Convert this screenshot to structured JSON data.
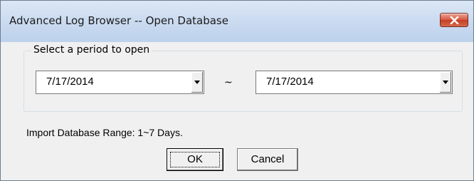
{
  "window": {
    "title": "Advanced Log Browser -- Open Database"
  },
  "titlebar_buttons": {
    "close_icon": "close-x-icon",
    "close_color": "#c9452f"
  },
  "period_group": {
    "legend": "Select a period to open",
    "start_date": "7/17/2014",
    "separator": "~",
    "end_date": "7/17/2014",
    "dropdown_icon": "chevron-down-icon"
  },
  "info": {
    "import_range": "Import Database Range: 1~7 Days."
  },
  "buttons": {
    "ok_label": "OK",
    "cancel_label": "Cancel"
  }
}
